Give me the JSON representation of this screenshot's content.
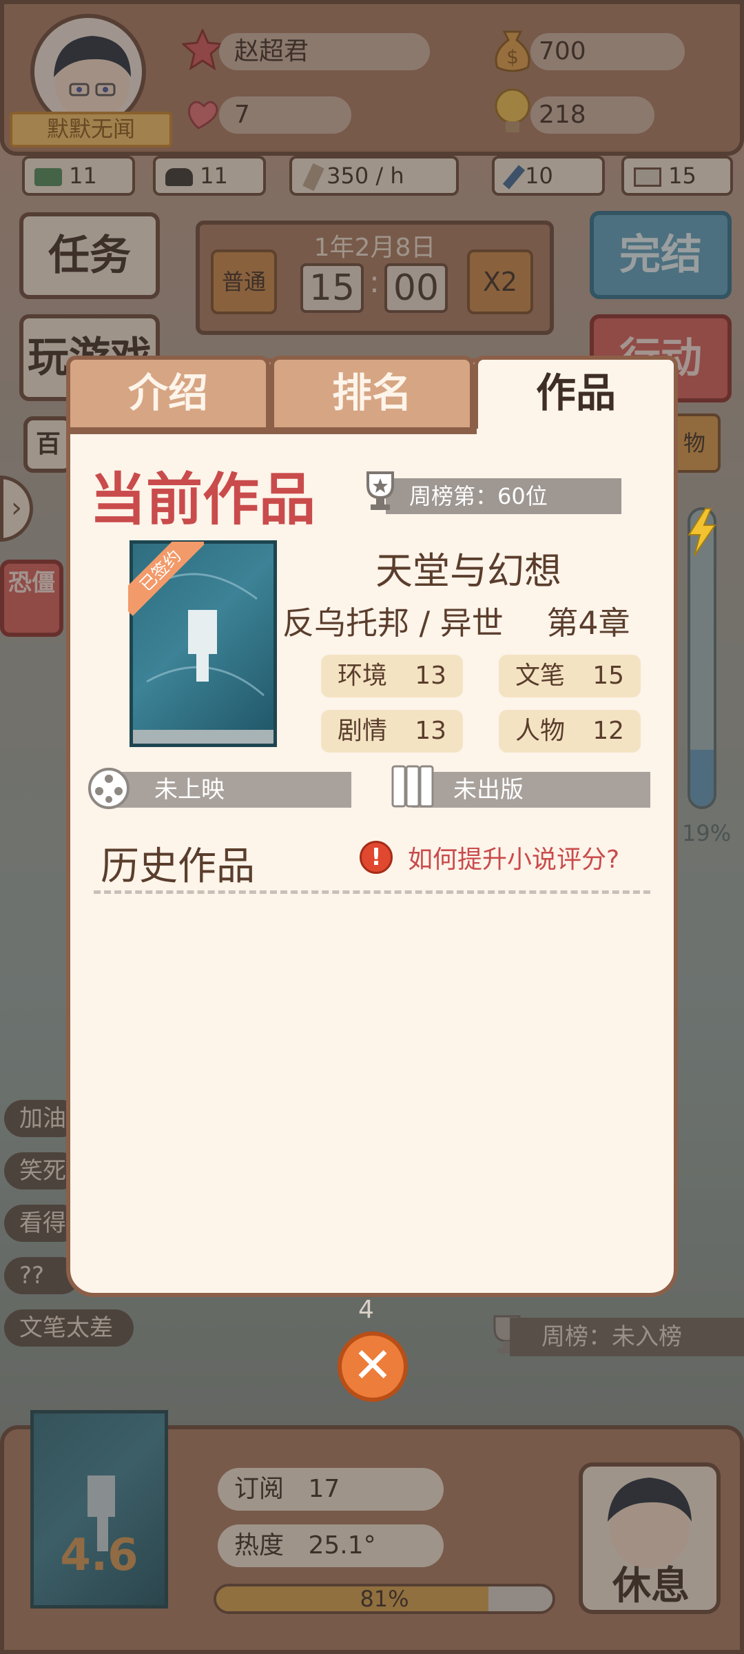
{
  "player": {
    "name": "赵超君",
    "title": "默默无闻",
    "hearts": "7",
    "money": "700",
    "inspiration": "218"
  },
  "stats": [
    {
      "icon": "money-stack-icon",
      "value": "11"
    },
    {
      "icon": "hat-icon",
      "value": "11"
    },
    {
      "icon": "pen-icon",
      "value": "350 / h"
    },
    {
      "icon": "brush-icon",
      "value": "10"
    },
    {
      "icon": "book-icon",
      "value": "15"
    }
  ],
  "game": {
    "date": "1年2月8日",
    "mode": "普通",
    "hour": "15",
    "minute": "00",
    "speed": "X2",
    "task_label": "任务",
    "play_label": "玩游戏",
    "finish_label": "完结",
    "action_label": "行动",
    "left_side_label": "百",
    "right_side_label": "物",
    "left_red_label": "恐僵",
    "energy_percent": 19,
    "energy_label": "19%",
    "side_list": [
      "加油",
      "笑死",
      "看得",
      "??",
      "文笔太差"
    ],
    "behind_modal_number": "4",
    "weekly_rank_bottom": "周榜：未入榜"
  },
  "modal": {
    "tabs": [
      "介绍",
      "排名",
      "作品"
    ],
    "active_tab": 2,
    "current_heading": "当前作品",
    "weekly_rank": "周榜第：60位",
    "signed_badge": "已签约",
    "book_title": "天堂与幻想",
    "book_genre": "反乌托邦 / 异世",
    "book_chapter": "第4章",
    "attributes": [
      {
        "label": "环境",
        "value": "13"
      },
      {
        "label": "文笔",
        "value": "15"
      },
      {
        "label": "剧情",
        "value": "13"
      },
      {
        "label": "人物",
        "value": "12"
      }
    ],
    "film_status": "未上映",
    "publish_status": "未出版",
    "history_heading": "历史作品",
    "tip_text": "如何提升小说评分?"
  },
  "bottom": {
    "score": "4.6",
    "subscribe_label": "订阅",
    "subscribe_value": "17",
    "heat_label": "热度",
    "heat_value": "25.1°",
    "progress": 81,
    "progress_label": "81%",
    "rest_label": "休息"
  },
  "colors": {
    "accent_red": "#c94b4b",
    "panel_brown": "#a97a62",
    "border_brown": "#6b4a39",
    "blue_button": "#5aa3c2",
    "close_orange": "#ec7d3a"
  }
}
